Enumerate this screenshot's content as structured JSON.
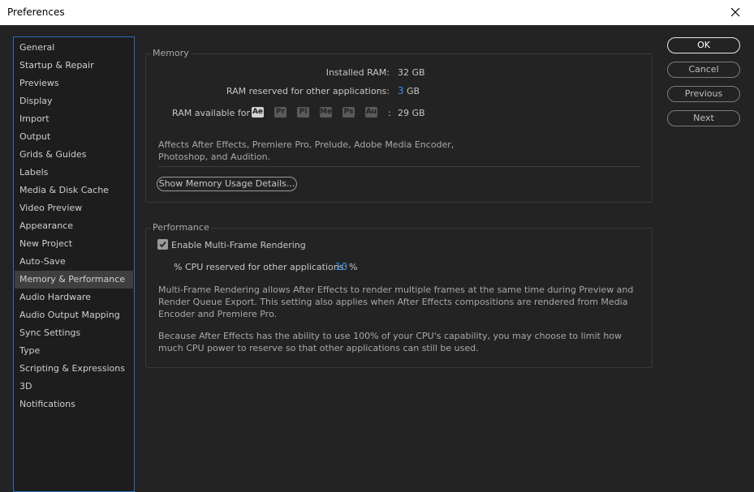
{
  "window": {
    "title": "Preferences"
  },
  "sidebar": {
    "items": [
      "General",
      "Startup & Repair",
      "Previews",
      "Display",
      "Import",
      "Output",
      "Grids & Guides",
      "Labels",
      "Media & Disk Cache",
      "Video Preview",
      "Appearance",
      "New Project",
      "Auto-Save",
      "Memory & Performance",
      "Audio Hardware",
      "Audio Output Mapping",
      "Sync Settings",
      "Type",
      "Scripting & Expressions",
      "3D",
      "Notifications"
    ],
    "selected": "Memory & Performance"
  },
  "memory": {
    "label": "Memory",
    "installed_label": "Installed RAM:",
    "installed_value": "32 GB",
    "reserved_label": "RAM reserved for other applications:",
    "reserved_value": "3",
    "reserved_unit": "GB",
    "available_label": "RAM available for",
    "apps": [
      "Ae",
      "Pr",
      "Pl",
      "Me",
      "Ps",
      "Au"
    ],
    "available_colon": ":",
    "available_value": "29 GB",
    "affects_line1": "Affects After Effects, Premiere Pro, Prelude, Adobe Media Encoder,",
    "affects_line2": "Photoshop, and Audition.",
    "details_button": "Show Memory Usage Details..."
  },
  "performance": {
    "label": "Performance",
    "mfr_label": "Enable Multi-Frame Rendering",
    "mfr_checked": true,
    "cpu_label": "% CPU reserved for other applications:",
    "cpu_value": "10",
    "cpu_unit": "%",
    "desc1_line1": "Multi-Frame Rendering allows After Effects to render multiple frames at the same time during Preview and",
    "desc1_line2": "Render Queue Export. This setting also applies when After Effects compositions are rendered from Media",
    "desc1_line3": "Encoder and Premiere Pro.",
    "desc2_line1": "Because After Effects has the ability to use 100% of your CPU's capability, you may choose to limit how",
    "desc2_line2": "much CPU power to reserve so that other applications can still be used."
  },
  "buttons": {
    "ok": "OK",
    "cancel": "Cancel",
    "previous": "Previous",
    "next": "Next"
  },
  "icons": {
    "close": "close-icon",
    "check": "checkmark-icon"
  },
  "colors": {
    "accent": "#2f8fef",
    "sidebar_border": "#2d6dbf",
    "background": "#232323"
  }
}
